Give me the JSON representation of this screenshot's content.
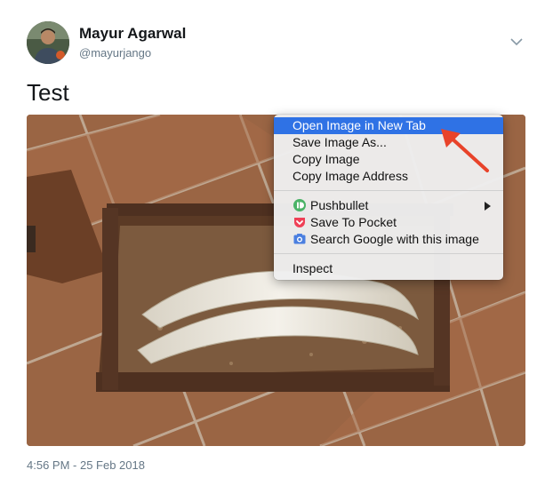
{
  "tweet": {
    "author_name": "Mayur Agarwal",
    "author_handle": "@mayurjango",
    "text": "Test",
    "timestamp": "4:56 PM - 25 Feb 2018"
  },
  "context_menu": {
    "items": [
      {
        "label": "Open Image in New Tab",
        "highlighted": true
      },
      {
        "label": "Save Image As..."
      },
      {
        "label": "Copy Image"
      },
      {
        "label": "Copy Image Address"
      },
      {
        "label": "Pushbullet",
        "icon": "pushbullet-icon",
        "submenu": true
      },
      {
        "label": "Save To Pocket",
        "icon": "pocket-icon"
      },
      {
        "label": "Search Google with this image",
        "icon": "google-camera-icon"
      },
      {
        "label": "Inspect"
      }
    ]
  },
  "colors": {
    "highlight": "#2f72e5",
    "annotation_arrow": "#e8432a",
    "name": "#14171a",
    "muted": "#657786"
  }
}
